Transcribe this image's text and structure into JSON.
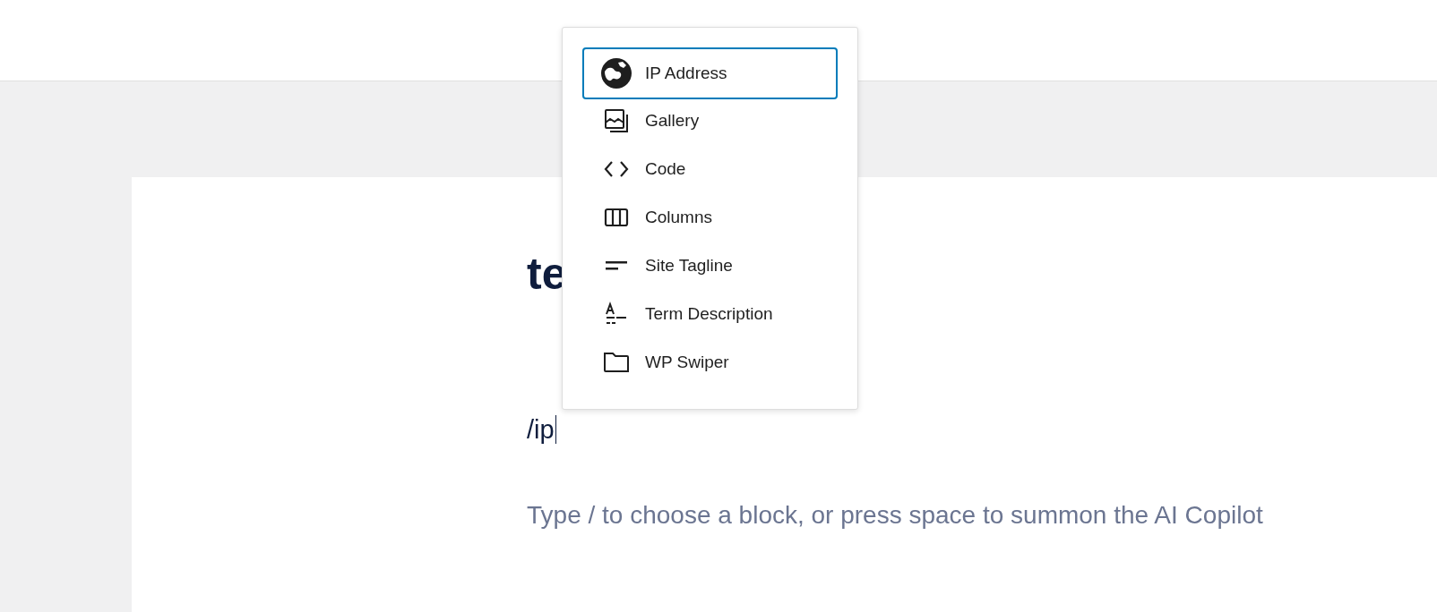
{
  "editor": {
    "title": "te",
    "typed_text": "/ip",
    "placeholder": "Type / to choose a block, or press space to summon the AI Copilot"
  },
  "block_menu": {
    "items": [
      {
        "label": "IP Address",
        "kind": "globe",
        "selected": true
      },
      {
        "label": "Gallery",
        "kind": "gallery",
        "selected": false
      },
      {
        "label": "Code",
        "kind": "code",
        "selected": false
      },
      {
        "label": "Columns",
        "kind": "columns",
        "selected": false
      },
      {
        "label": "Site Tagline",
        "kind": "tagline",
        "selected": false
      },
      {
        "label": "Term Description",
        "kind": "term",
        "selected": false
      },
      {
        "label": "WP Swiper",
        "kind": "folder",
        "selected": false
      }
    ]
  }
}
